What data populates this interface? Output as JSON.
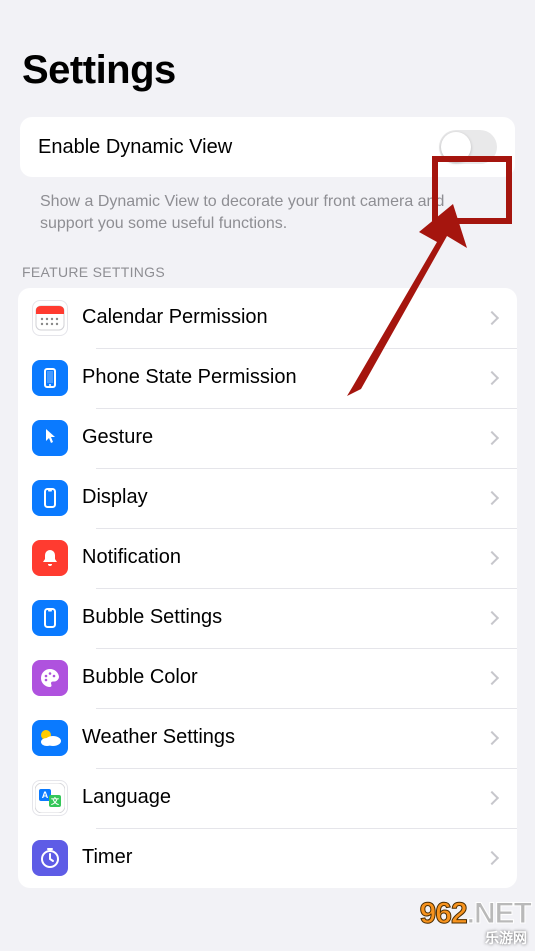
{
  "title": "Settings",
  "enable_row": {
    "label": "Enable Dynamic View",
    "enabled": false
  },
  "enable_desc": "Show a Dynamic View to decorate your front camera and support you some useful functions.",
  "section_header": "FEATURE SETTINGS",
  "items": [
    {
      "name": "calendar-permission",
      "label": "Calendar Permission",
      "icon": "calendar",
      "bg": "#ffffff",
      "fg": "#ff3b30"
    },
    {
      "name": "phone-state-permission",
      "label": "Phone State Permission",
      "icon": "phone",
      "bg": "#0a7aff",
      "fg": "#ffffff"
    },
    {
      "name": "gesture",
      "label": "Gesture",
      "icon": "pointer",
      "bg": "#0a7aff",
      "fg": "#ffffff"
    },
    {
      "name": "display",
      "label": "Display",
      "icon": "display",
      "bg": "#0a7aff",
      "fg": "#ffffff"
    },
    {
      "name": "notification",
      "label": "Notification",
      "icon": "bell",
      "bg": "#ff3b30",
      "fg": "#ffffff"
    },
    {
      "name": "bubble-settings",
      "label": "Bubble Settings",
      "icon": "display",
      "bg": "#0a7aff",
      "fg": "#ffffff"
    },
    {
      "name": "bubble-color",
      "label": "Bubble Color",
      "icon": "palette",
      "bg": "#af52de",
      "fg": "#ffffff"
    },
    {
      "name": "weather-settings",
      "label": "Weather Settings",
      "icon": "weather",
      "bg": "#0a7aff",
      "fg": "#ffffff"
    },
    {
      "name": "language",
      "label": "Language",
      "icon": "language",
      "bg": "#ffffff",
      "fg": "#0a7aff"
    },
    {
      "name": "timer",
      "label": "Timer",
      "icon": "timer",
      "bg": "#5e5ce6",
      "fg": "#ffffff"
    }
  ],
  "annotation": {
    "highlight_color": "#a5150e"
  },
  "watermark": {
    "top": "962.NET",
    "bottom": "乐游网"
  }
}
